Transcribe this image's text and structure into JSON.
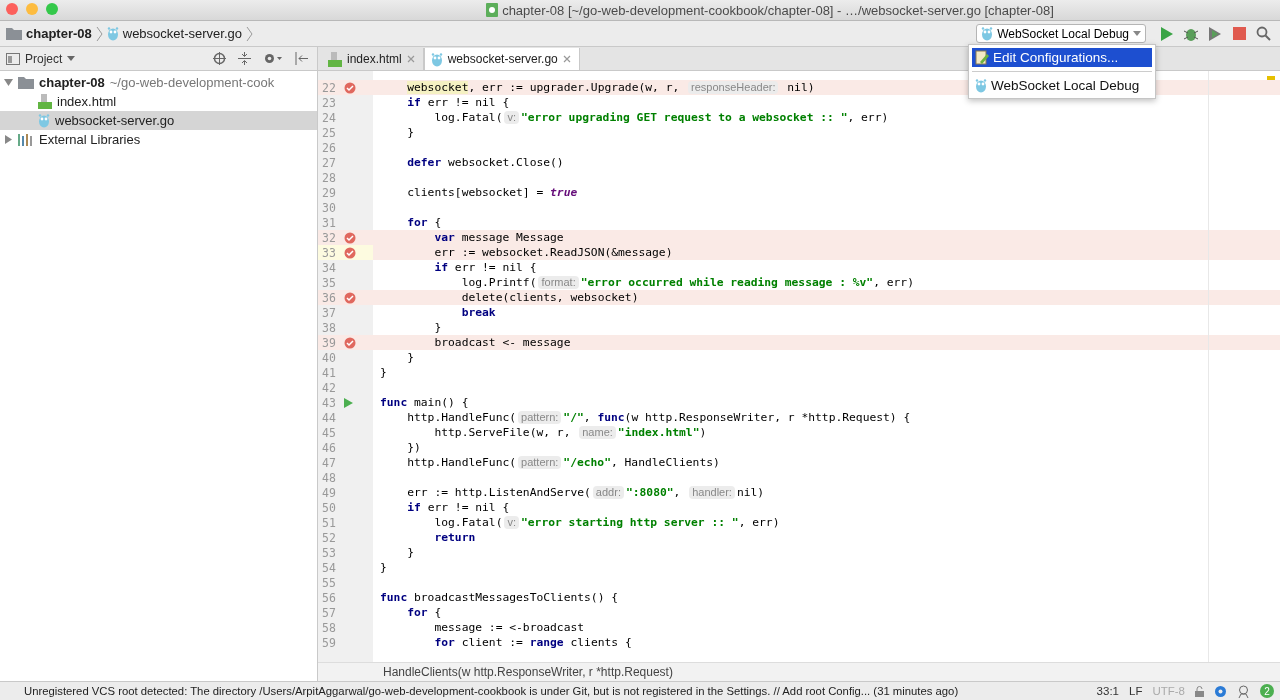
{
  "window": {
    "title": "chapter-08 [~/go-web-development-cookbook/chapter-08] - …/websocket-server.go [chapter-08]"
  },
  "breadcrumbs": [
    {
      "label": "chapter-08",
      "kind": "folder"
    },
    {
      "label": "websocket-server.go",
      "kind": "go"
    }
  ],
  "run_config": {
    "label": "WebSocket Local Debug"
  },
  "run_menu": {
    "items": [
      {
        "label": "Edit Configurations...",
        "kind": "edit",
        "selected": true
      },
      {
        "label": "WebSocket Local Debug",
        "kind": "go",
        "selected": false
      }
    ]
  },
  "project_panel": {
    "title": "Project",
    "tree": [
      {
        "label": "chapter-08",
        "path": "~/go-web-development-cook",
        "kind": "folder",
        "expanded": true,
        "selected": false,
        "children": [
          {
            "label": "index.html",
            "kind": "html",
            "selected": false
          },
          {
            "label": "websocket-server.go",
            "kind": "go",
            "selected": true
          }
        ]
      },
      {
        "label": "External Libraries",
        "kind": "library",
        "expanded": false,
        "selected": false
      }
    ]
  },
  "tabs": [
    {
      "label": "index.html",
      "kind": "html",
      "selected": false
    },
    {
      "label": "websocket-server.go",
      "kind": "go",
      "selected": true
    }
  ],
  "editor": {
    "lines": [
      {
        "n": "22",
        "breakpoint": true,
        "current": false,
        "segs": [
          {
            "kind": "mark",
            "t": "    websocket"
          },
          {
            "kind": "plain",
            "t": ", err := upgrader.Upgrade(w, r, "
          },
          {
            "kind": "hint",
            "t": "responseHeader:"
          },
          {
            "kind": "plain",
            "t": " nil)"
          }
        ]
      },
      {
        "n": "23",
        "breakpoint": false,
        "current": false,
        "segs": [
          {
            "kind": "keyword",
            "t": "    if"
          },
          {
            "kind": "plain",
            "t": " err != nil {"
          }
        ]
      },
      {
        "n": "24",
        "breakpoint": false,
        "current": false,
        "segs": [
          {
            "kind": "plain",
            "t": "        log.Fatal("
          },
          {
            "kind": "hint",
            "t": "v:"
          },
          {
            "kind": "string",
            "t": "\"error upgrading GET request to a websocket :: \""
          },
          {
            "kind": "plain",
            "t": ", err)"
          }
        ]
      },
      {
        "n": "25",
        "breakpoint": false,
        "current": false,
        "segs": [
          {
            "kind": "plain",
            "t": "    }"
          }
        ]
      },
      {
        "n": "26",
        "breakpoint": false,
        "current": false
      },
      {
        "n": "27",
        "breakpoint": false,
        "current": false,
        "segs": [
          {
            "kind": "keyword",
            "t": "    defer"
          },
          {
            "kind": "plain",
            "t": " websocket.Close()"
          }
        ]
      },
      {
        "n": "28",
        "breakpoint": false,
        "current": false
      },
      {
        "n": "29",
        "breakpoint": false,
        "current": false,
        "segs": [
          {
            "kind": "plain",
            "t": "    clients[websocket] = "
          },
          {
            "kind": "literal",
            "t": "true"
          }
        ]
      },
      {
        "n": "30",
        "breakpoint": false,
        "current": false
      },
      {
        "n": "31",
        "breakpoint": false,
        "current": false,
        "segs": [
          {
            "kind": "keyword",
            "t": "    for"
          },
          {
            "kind": "plain",
            "t": " {"
          }
        ]
      },
      {
        "n": "32",
        "breakpoint": true,
        "current": false,
        "segs": [
          {
            "kind": "keyword",
            "t": "        var"
          },
          {
            "kind": "plain",
            "t": " message Message"
          }
        ]
      },
      {
        "n": "33",
        "breakpoint": true,
        "current": true,
        "segs": [
          {
            "kind": "plain",
            "t": "        err := websocket.ReadJSON(&message)"
          }
        ]
      },
      {
        "n": "34",
        "breakpoint": false,
        "current": false,
        "segs": [
          {
            "kind": "keyword",
            "t": "        if"
          },
          {
            "kind": "plain",
            "t": " err != nil {"
          }
        ]
      },
      {
        "n": "35",
        "breakpoint": false,
        "current": false,
        "segs": [
          {
            "kind": "plain",
            "t": "            log.Printf("
          },
          {
            "kind": "hint",
            "t": "format:"
          },
          {
            "kind": "string",
            "t": "\"error occurred while reading message : %v\""
          },
          {
            "kind": "plain",
            "t": ", err)"
          }
        ]
      },
      {
        "n": "36",
        "breakpoint": true,
        "current": false,
        "segs": [
          {
            "kind": "plain",
            "t": "            delete(clients, websocket)"
          }
        ]
      },
      {
        "n": "37",
        "breakpoint": false,
        "current": false,
        "segs": [
          {
            "kind": "keyword",
            "t": "            break"
          }
        ]
      },
      {
        "n": "38",
        "breakpoint": false,
        "current": false,
        "segs": [
          {
            "kind": "plain",
            "t": "        }"
          }
        ]
      },
      {
        "n": "39",
        "breakpoint": true,
        "current": false,
        "segs": [
          {
            "kind": "plain",
            "t": "        broadcast <- message"
          }
        ]
      },
      {
        "n": "40",
        "breakpoint": false,
        "current": false,
        "segs": [
          {
            "kind": "plain",
            "t": "    }"
          }
        ]
      },
      {
        "n": "41",
        "breakpoint": false,
        "current": false,
        "segs": [
          {
            "kind": "plain",
            "t": "}"
          }
        ]
      },
      {
        "n": "42",
        "breakpoint": false,
        "current": false
      },
      {
        "n": "43",
        "breakpoint": false,
        "current": false,
        "run": true,
        "segs": [
          {
            "kind": "keyword",
            "t": "func"
          },
          {
            "kind": "plain",
            "t": " main() {"
          }
        ]
      },
      {
        "n": "44",
        "breakpoint": false,
        "current": false,
        "segs": [
          {
            "kind": "plain",
            "t": "    http.HandleFunc("
          },
          {
            "kind": "hint",
            "t": "pattern:"
          },
          {
            "kind": "string",
            "t": "\"/\""
          },
          {
            "kind": "plain",
            "t": ", "
          },
          {
            "kind": "keyword",
            "t": "func"
          },
          {
            "kind": "plain",
            "t": "(w http.ResponseWriter, r *http.Request) {"
          }
        ]
      },
      {
        "n": "45",
        "breakpoint": false,
        "current": false,
        "segs": [
          {
            "kind": "plain",
            "t": "        http.ServeFile(w, r, "
          },
          {
            "kind": "hint",
            "t": "name:"
          },
          {
            "kind": "string",
            "t": "\"index.html\""
          },
          {
            "kind": "plain",
            "t": ")"
          }
        ]
      },
      {
        "n": "46",
        "breakpoint": false,
        "current": false,
        "segs": [
          {
            "kind": "plain",
            "t": "    })"
          }
        ]
      },
      {
        "n": "47",
        "breakpoint": false,
        "current": false,
        "segs": [
          {
            "kind": "plain",
            "t": "    http.HandleFunc("
          },
          {
            "kind": "hint",
            "t": "pattern:"
          },
          {
            "kind": "string",
            "t": "\"/echo\""
          },
          {
            "kind": "plain",
            "t": ", HandleClients)"
          }
        ]
      },
      {
        "n": "48",
        "breakpoint": false,
        "current": false
      },
      {
        "n": "49",
        "breakpoint": false,
        "current": false,
        "segs": [
          {
            "kind": "plain",
            "t": "    err := http.ListenAndServe("
          },
          {
            "kind": "hint",
            "t": "addr:"
          },
          {
            "kind": "string",
            "t": "\":8080\""
          },
          {
            "kind": "plain",
            "t": ", "
          },
          {
            "kind": "hint",
            "t": "handler:"
          },
          {
            "kind": "plain",
            "t": "nil)"
          }
        ]
      },
      {
        "n": "50",
        "breakpoint": false,
        "current": false,
        "segs": [
          {
            "kind": "keyword",
            "t": "    if"
          },
          {
            "kind": "plain",
            "t": " err != nil {"
          }
        ]
      },
      {
        "n": "51",
        "breakpoint": false,
        "current": false,
        "segs": [
          {
            "kind": "plain",
            "t": "        log.Fatal("
          },
          {
            "kind": "hint",
            "t": "v:"
          },
          {
            "kind": "string",
            "t": "\"error starting http server :: \""
          },
          {
            "kind": "plain",
            "t": ", err)"
          }
        ]
      },
      {
        "n": "52",
        "breakpoint": false,
        "current": false,
        "segs": [
          {
            "kind": "keyword",
            "t": "        return"
          }
        ]
      },
      {
        "n": "53",
        "breakpoint": false,
        "current": false,
        "segs": [
          {
            "kind": "plain",
            "t": "    }"
          }
        ]
      },
      {
        "n": "54",
        "breakpoint": false,
        "current": false,
        "segs": [
          {
            "kind": "plain",
            "t": "}"
          }
        ]
      },
      {
        "n": "55",
        "breakpoint": false,
        "current": false
      },
      {
        "n": "56",
        "breakpoint": false,
        "current": false,
        "segs": [
          {
            "kind": "keyword",
            "t": "func"
          },
          {
            "kind": "plain",
            "t": " broadcastMessagesToClients() {"
          }
        ]
      },
      {
        "n": "57",
        "breakpoint": false,
        "current": false,
        "segs": [
          {
            "kind": "keyword",
            "t": "    for"
          },
          {
            "kind": "plain",
            "t": " {"
          }
        ]
      },
      {
        "n": "58",
        "breakpoint": false,
        "current": false,
        "segs": [
          {
            "kind": "plain",
            "t": "        message := <-broadcast"
          }
        ]
      },
      {
        "n": "59",
        "breakpoint": false,
        "current": false,
        "segs": [
          {
            "kind": "keyword",
            "t": "        for"
          },
          {
            "kind": "plain",
            "t": " client := "
          },
          {
            "kind": "keyword",
            "t": "range"
          },
          {
            "kind": "plain",
            "t": " clients {"
          }
        ]
      }
    ],
    "signature_hint": "HandleClients(w http.ResponseWriter, r *http.Request)"
  },
  "status_bar": {
    "message": "Unregistered VCS root detected: The directory /Users/ArpitAggarwal/go-web-development-cookbook is under Git, but is not registered in the Settings. // Add root  Config... (31 minutes ago)",
    "position": "33:1",
    "line_separator": "LF",
    "encoding": "UTF-8",
    "notifications": "2"
  }
}
